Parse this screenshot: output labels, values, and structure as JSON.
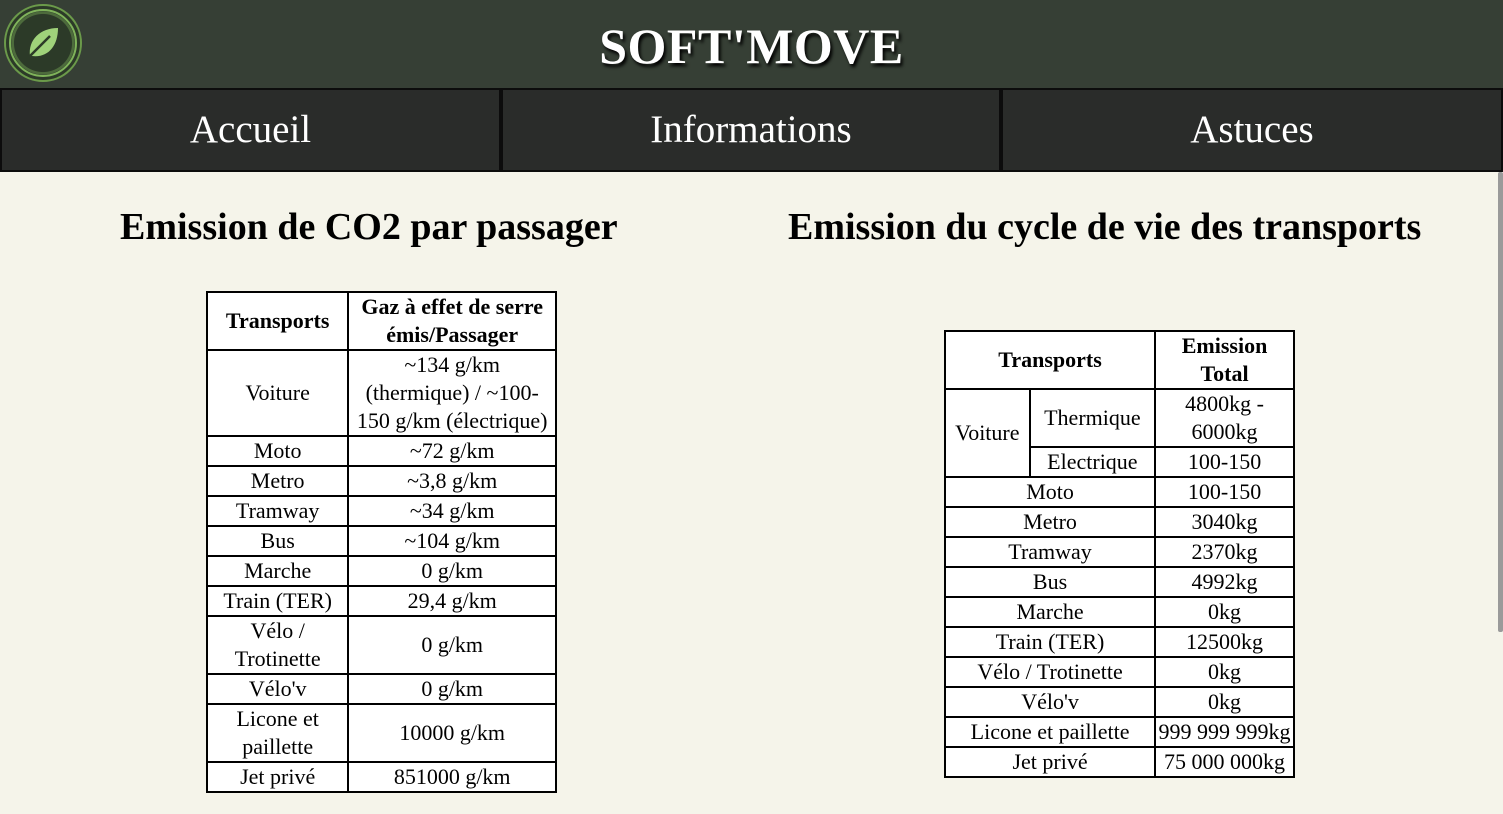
{
  "header": {
    "title": "SOFT'MOVE",
    "logo_icon": "leaf-icon"
  },
  "nav": {
    "items": [
      "Accueil",
      "Informations",
      "Astuces"
    ]
  },
  "left_section": {
    "title": "Emission de CO2 par passager",
    "table": {
      "headers": [
        "Transports",
        "Gaz à effet de serre émis/Passager"
      ],
      "rows": [
        [
          "Voiture",
          "~134 g/km (thermique) / ~100-150 g/km (électrique)"
        ],
        [
          "Moto",
          "~72 g/km"
        ],
        [
          "Metro",
          "~3,8 g/km"
        ],
        [
          "Tramway",
          "~34 g/km"
        ],
        [
          "Bus",
          "~104 g/km"
        ],
        [
          "Marche",
          "0 g/km"
        ],
        [
          "Train (TER)",
          "29,4 g/km"
        ],
        [
          "Vélo / Trotinette",
          "0 g/km"
        ],
        [
          "Vélo'v",
          "0 g/km"
        ],
        [
          "Licone et paillette",
          "10000 g/km"
        ],
        [
          "Jet privé",
          "851000 g/km"
        ]
      ]
    }
  },
  "right_section": {
    "title": "Emission du cycle de vie des transports",
    "table": {
      "headers": [
        "Transports",
        "Emission Total"
      ],
      "voiture": {
        "label": "Voiture",
        "sub": [
          [
            "Thermique",
            "4800kg - 6000kg"
          ],
          [
            "Electrique",
            "100-150"
          ]
        ]
      },
      "rows": [
        [
          "Moto",
          "100-150"
        ],
        [
          "Metro",
          "3040kg"
        ],
        [
          "Tramway",
          "2370kg"
        ],
        [
          "Bus",
          "4992kg"
        ],
        [
          "Marche",
          "0kg"
        ],
        [
          "Train (TER)",
          "12500kg"
        ],
        [
          "Vélo / Trotinette",
          "0kg"
        ],
        [
          "Vélo'v",
          "0kg"
        ],
        [
          "Licone et paillette",
          "999 999 999kg"
        ],
        [
          "Jet privé",
          "75 000 000kg"
        ]
      ]
    }
  },
  "colors": {
    "header_bg": "#363f35",
    "nav_bg": "#2a2c2a",
    "page_bg": "#f5f4ea",
    "logo_green": "#8fc76a"
  }
}
